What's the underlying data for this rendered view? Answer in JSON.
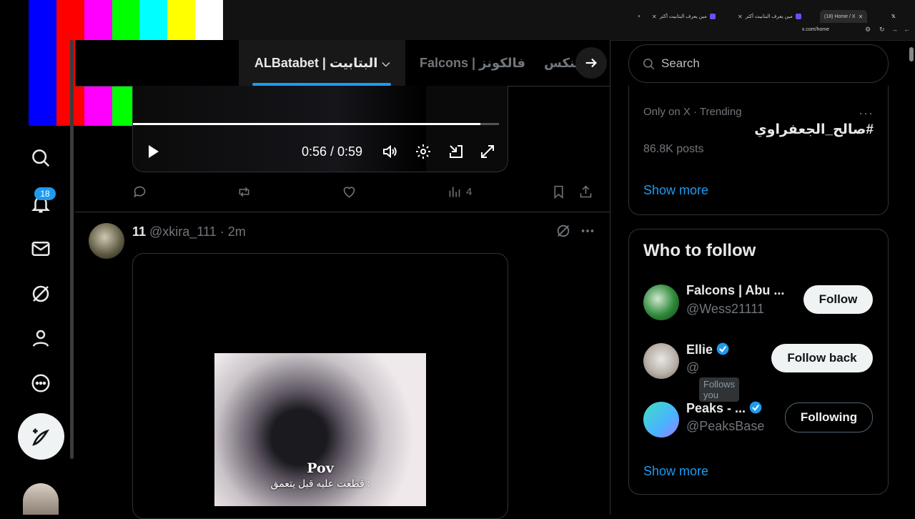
{
  "browser": {
    "tabs": [
      {
        "title": "(18) Home / X"
      },
      {
        "title": "مين يعرف البتابيت أكثر"
      },
      {
        "title": "مين يعرف البتابيت أكثر"
      }
    ],
    "address": "x.com/home"
  },
  "color_bars": [
    "#0000ff",
    "#ff0000",
    "#ff00ff",
    "#00ff00",
    "#00ffff",
    "#ffff00",
    "#ffffff"
  ],
  "nav": {
    "icons": [
      "search-icon",
      "notifications-icon",
      "messages-icon",
      "grok-icon",
      "profile-icon",
      "more-icon"
    ],
    "notifications_badge": "18",
    "post_button_icon": "compose-icon"
  },
  "feed_tabs": {
    "active": "ALBatabet | البتابيت",
    "second": "Falcons | فالكونز",
    "third": "ينكس"
  },
  "video_post": {
    "time": "0:56 / 0:59",
    "progress": 0.95,
    "views": "4"
  },
  "post2": {
    "name": "11",
    "handle": "@xkira_111",
    "dot": "·",
    "time": "2m",
    "caption_title": "Pov",
    "caption_sub": "قطعت عليه قبل يتعمق :"
  },
  "search": {
    "placeholder": "Search"
  },
  "trending": {
    "context": "Only on X · Trending",
    "more": "···",
    "topic": "#صالح_الجعفراوي",
    "count": "86.8K posts",
    "show_more": "Show more"
  },
  "who_to_follow": {
    "title": "Who to follow",
    "users": [
      {
        "name": "Falcons | Abu ...",
        "handle": "@Wess21111",
        "button": "Follow",
        "verified": false
      },
      {
        "name": "Ellie",
        "handle": "@",
        "follows_you": "Follows you",
        "button": "Follow back",
        "verified": true
      },
      {
        "name": "Peaks - ...",
        "handle": "@PeaksBase",
        "button": "Following",
        "verified": true
      }
    ],
    "show_more": "Show more"
  },
  "colors": {
    "accent": "#1d9bf0",
    "background": "#000000",
    "border": "#2f3336",
    "muted_text": "#71767b"
  }
}
